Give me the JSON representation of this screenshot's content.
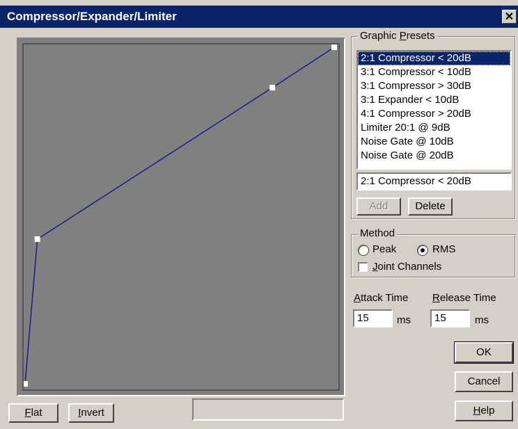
{
  "window": {
    "title": "Compressor/Expander/Limiter",
    "close_symbol": "✕"
  },
  "graph": {
    "points": [
      {
        "input": 0,
        "output": 0
      },
      {
        "input": 4,
        "output": 43
      },
      {
        "input": 80,
        "output": 88
      },
      {
        "input": 100,
        "output": 100
      }
    ]
  },
  "bottom_buttons": {
    "flat": {
      "underline": "F",
      "rest": "lat"
    },
    "invert": {
      "underline": "I",
      "rest": "nvert"
    }
  },
  "presets": {
    "group_label": {
      "pre": "Graphic ",
      "underline": "P",
      "rest": "resets"
    },
    "items": [
      "2:1 Compressor < 20dB",
      "3:1 Compressor < 10dB",
      "3:1 Compressor > 30dB",
      "3:1 Expander < 10dB",
      "4:1 Compressor > 20dB",
      "Limiter 20:1 @ 9dB",
      "Noise Gate @ 10dB",
      "Noise Gate @ 20dB"
    ],
    "selected_index": 0,
    "name_value": "2:1 Compressor < 20dB",
    "add_label": "Add",
    "delete_label": "Delete"
  },
  "method": {
    "group_label": "Method",
    "peak_label": "Peak",
    "rms_label": "RMS",
    "selected": "RMS",
    "joint": {
      "underline": "J",
      "rest": "oint Channels",
      "checked": false
    }
  },
  "attack": {
    "underline": "A",
    "rest": "ttack Time",
    "value": "15",
    "unit": "ms"
  },
  "release": {
    "underline": "R",
    "rest": "elease Time",
    "value": "15",
    "unit": "ms"
  },
  "actions": {
    "ok_label": "OK",
    "cancel_label": "Cancel",
    "help": {
      "underline": "H",
      "rest": "elp"
    }
  }
}
